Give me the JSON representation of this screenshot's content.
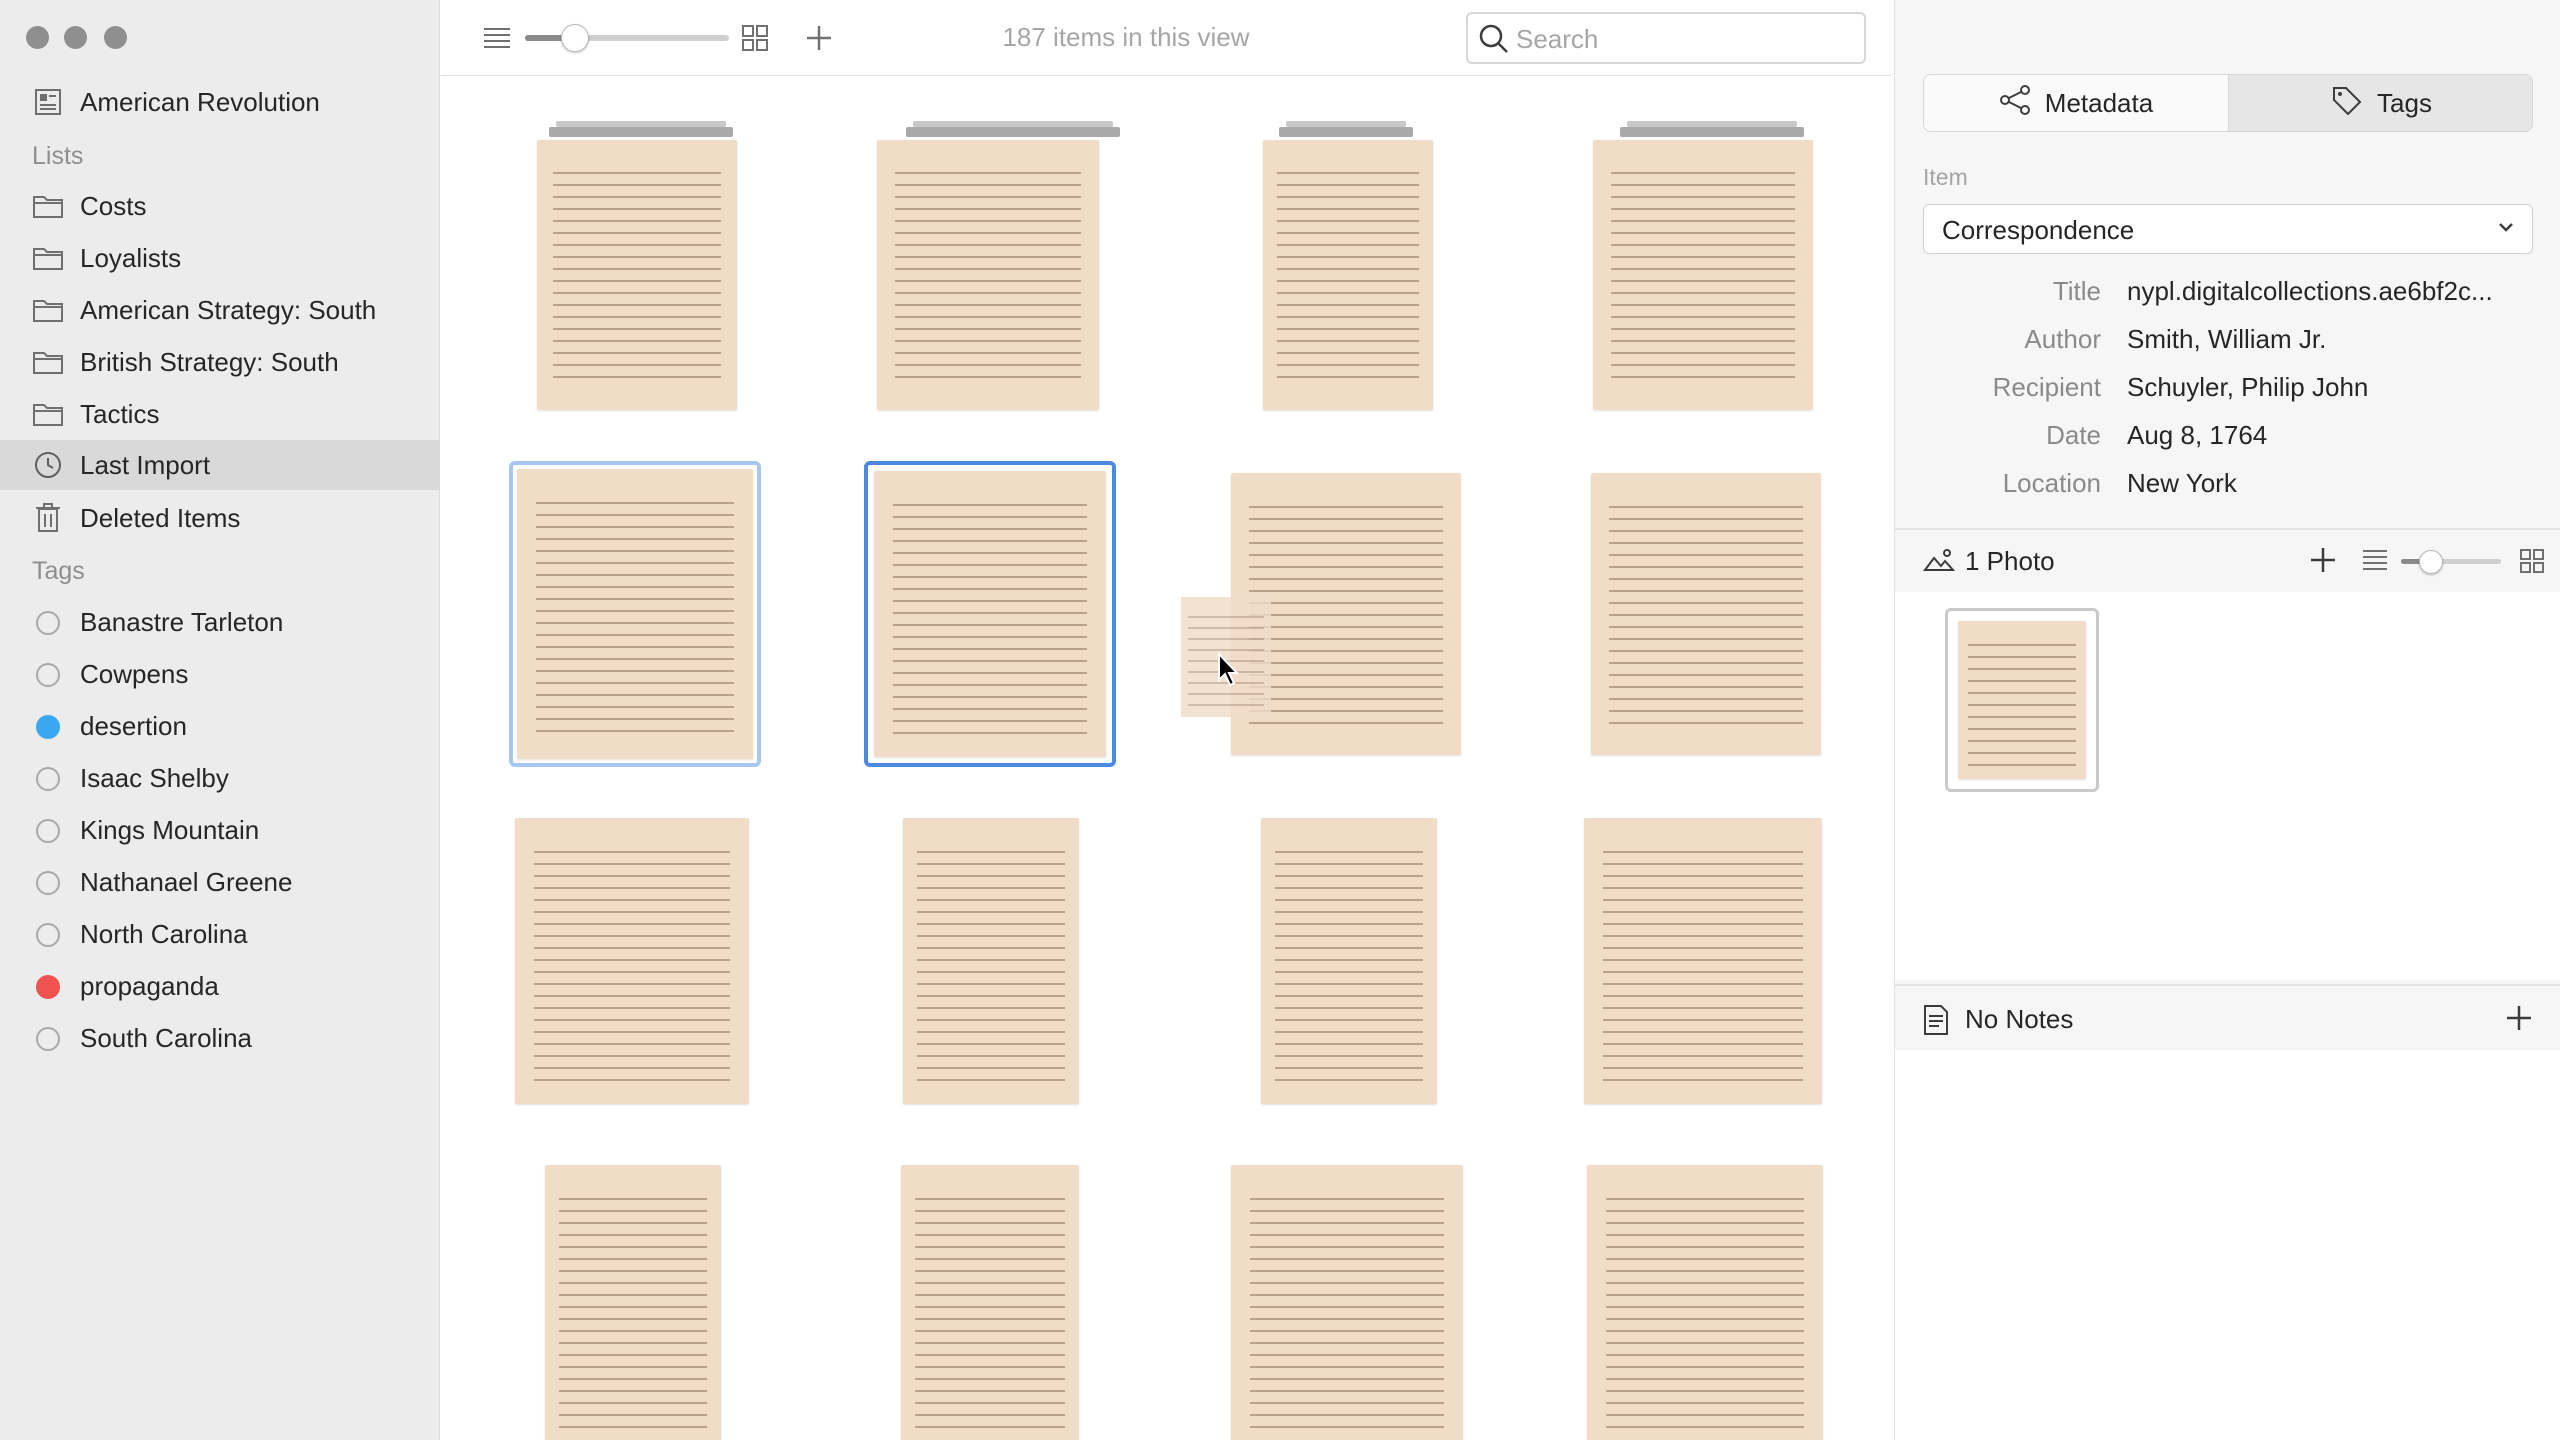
{
  "sidebar": {
    "library": "American Revolution",
    "lists_header": "Lists",
    "lists": [
      {
        "label": "Costs"
      },
      {
        "label": "Loyalists"
      },
      {
        "label": "American Strategy: South"
      },
      {
        "label": "British Strategy: South"
      },
      {
        "label": "Tactics"
      }
    ],
    "last_import": "Last Import",
    "deleted_items": "Deleted Items",
    "tags_header": "Tags",
    "tags": [
      {
        "label": "Banastre Tarleton",
        "color": ""
      },
      {
        "label": "Cowpens",
        "color": ""
      },
      {
        "label": "desertion",
        "color": "#3aa7f0"
      },
      {
        "label": "Isaac Shelby",
        "color": ""
      },
      {
        "label": "Kings Mountain",
        "color": ""
      },
      {
        "label": "Nathanael Greene",
        "color": ""
      },
      {
        "label": "North Carolina",
        "color": ""
      },
      {
        "label": "propaganda",
        "color": "#ef5350"
      },
      {
        "label": "South Carolina",
        "color": ""
      }
    ]
  },
  "toolbar": {
    "item_count": "187 items in this view",
    "search_placeholder": "Search",
    "zoom_level": 0.2
  },
  "inspector": {
    "tab_metadata": "Metadata",
    "tab_tags": "Tags",
    "item_label": "Item",
    "item_type": "Correspondence",
    "fields": [
      {
        "key": "Title",
        "value": "nypl.digitalcollections.ae6bf2c..."
      },
      {
        "key": "Author",
        "value": "Smith, William Jr."
      },
      {
        "key": "Recipient",
        "value": "Schuyler, Philip John"
      },
      {
        "key": "Date",
        "value": "Aug 8, 1764"
      },
      {
        "key": "Location",
        "value": "New York"
      }
    ],
    "photos_label": "1 Photo",
    "notes_label": "No Notes"
  },
  "colors": {
    "selection_primary": "#4c89df",
    "selection_secondary": "#a7c7f1",
    "paper": "#f1dcc8"
  }
}
